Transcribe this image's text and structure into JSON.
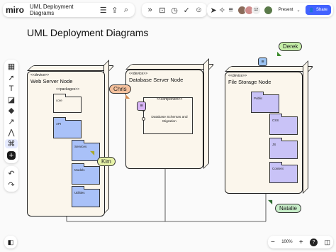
{
  "app": {
    "logo": "miro",
    "board_name": "UML Deployment Diagrams"
  },
  "topbar": {
    "icons": [
      "settings-sliders-icon",
      "export-icon",
      "search-icon"
    ],
    "center_icons": [
      "chevrons-icon",
      "frame-select-icon",
      "timer-icon",
      "vote-icon",
      "emoji-icon"
    ],
    "collab_icons": [
      "cursor-icon",
      "celebrate-icon",
      "list-icon"
    ],
    "avatar_count": "12",
    "present_label": "Present",
    "share_label": "Share",
    "accent": "#4262ff"
  },
  "board": {
    "title": "UML Deployment Diagrams",
    "nodes": [
      {
        "stereotype": "<<device>>",
        "title": "Web Server Node",
        "sub_stereotype": "<<packages>>"
      },
      {
        "stereotype": "<<device>>",
        "title": "Database Server Node",
        "sub_stereotype": "<<component>>",
        "component_label": "Database Schemas and Migration"
      },
      {
        "stereotype": "<<device>>",
        "title": "File Storage Node"
      }
    ],
    "web_packages": [
      "core",
      "API",
      "Services",
      "Models",
      "Utilities"
    ],
    "file_packages": [
      "Public",
      "CSS",
      "JS",
      "Content"
    ]
  },
  "cursors": [
    {
      "name": "Chris",
      "color": "#f6c29e"
    },
    {
      "name": "Derek",
      "color": "#c6efa8"
    },
    {
      "name": "Kim",
      "color": "#e7f3a8"
    },
    {
      "name": "Natalie",
      "color": "#c8eec9"
    }
  ],
  "zoom": {
    "level": "100%",
    "minus": "−",
    "plus": "+",
    "help": "?"
  },
  "colors": {
    "package_blue": "#a9c1f8",
    "package_purple": "#c9c3f7",
    "comment_purple": "#d8b4f6",
    "node_fill": "#fbf6ec"
  }
}
